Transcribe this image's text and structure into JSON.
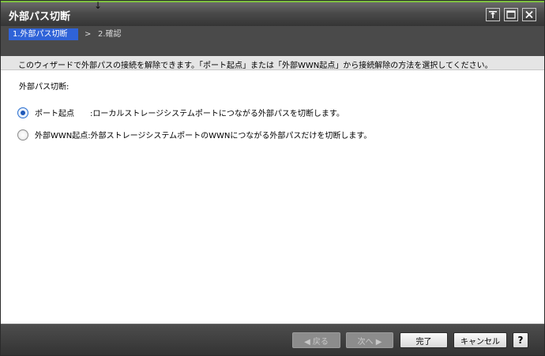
{
  "window": {
    "title": "外部パス切断"
  },
  "steps": {
    "current": "1.外部パス切断",
    "separator": ">",
    "next": "2.確認"
  },
  "description": "このウィザードで外部パスの接続を解除できます。「ポート起点」または「外部WWN起点」から接続解除の方法を選択してください。",
  "section": {
    "label": "外部パス切断:"
  },
  "options": [
    {
      "name": "ポート起点",
      "desc": ":ローカルストレージシステムポートにつながる外部パスを切断します。",
      "selected": true
    },
    {
      "name": "外部WWN起点",
      "desc": ":外部ストレージシステムポートのWWNにつながる外部パスだけを切断します。",
      "selected": false
    }
  ],
  "footer": {
    "back": "◀ 戻る",
    "next": "次へ ▶",
    "finish": "完了",
    "cancel": "キャンセル",
    "help": "?"
  },
  "icons": {
    "pin": "pin-icon",
    "maximize": "maximize-icon",
    "close": "close-icon"
  }
}
